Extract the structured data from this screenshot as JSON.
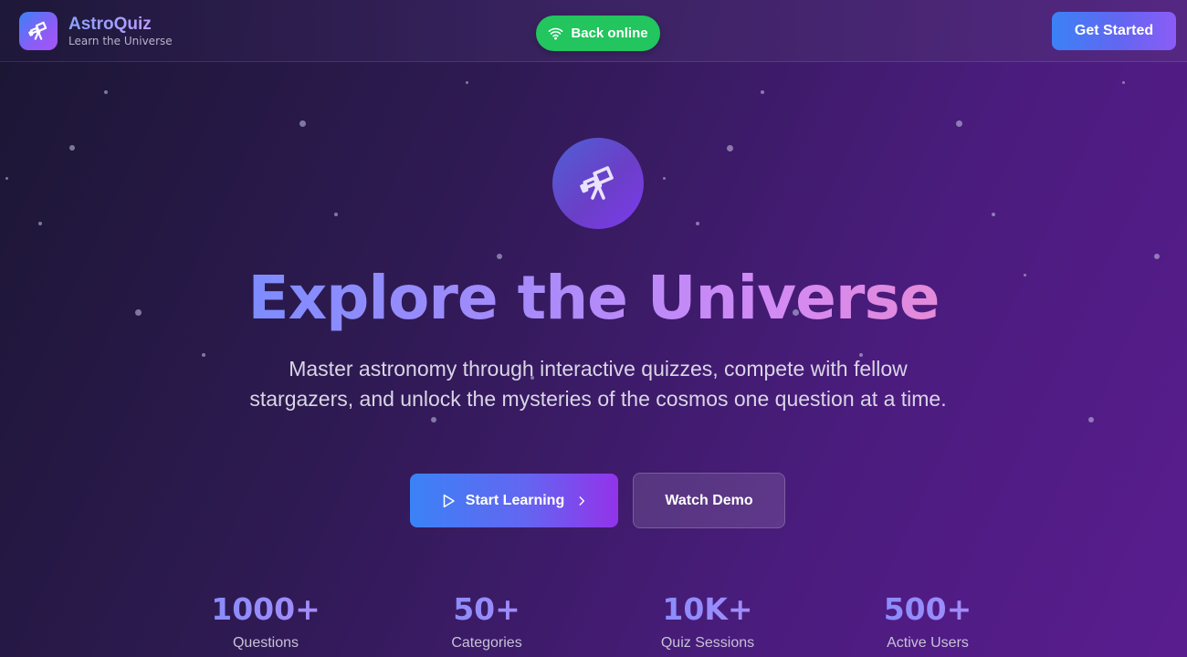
{
  "brand": {
    "name": "AstroQuiz",
    "tagline": "Learn the Universe",
    "logo_icon": "telescope-icon"
  },
  "status": {
    "label": "Back online",
    "icon": "wifi-icon",
    "color": "#22c55e"
  },
  "header": {
    "cta_label": "Get Started"
  },
  "hero": {
    "icon": "telescope-icon",
    "title": "Explore the Universe",
    "subtitle": "Master astronomy through interactive quizzes, compete with fellow stargazers, and unlock the mysteries of the cosmos one question at a time.",
    "primary_button": {
      "label": "Start Learning",
      "icon": "play-icon",
      "trailing_icon": "chevron-right-icon"
    },
    "secondary_button": {
      "label": "Watch Demo"
    }
  },
  "stats": [
    {
      "value": "1000+",
      "label": "Questions"
    },
    {
      "value": "50+",
      "label": "Categories"
    },
    {
      "value": "10K+",
      "label": "Quiz Sessions"
    },
    {
      "value": "500+",
      "label": "Active Users"
    }
  ],
  "colors": {
    "accent_blue": "#3b82f6",
    "accent_purple": "#8b5cf6",
    "success": "#22c55e"
  }
}
